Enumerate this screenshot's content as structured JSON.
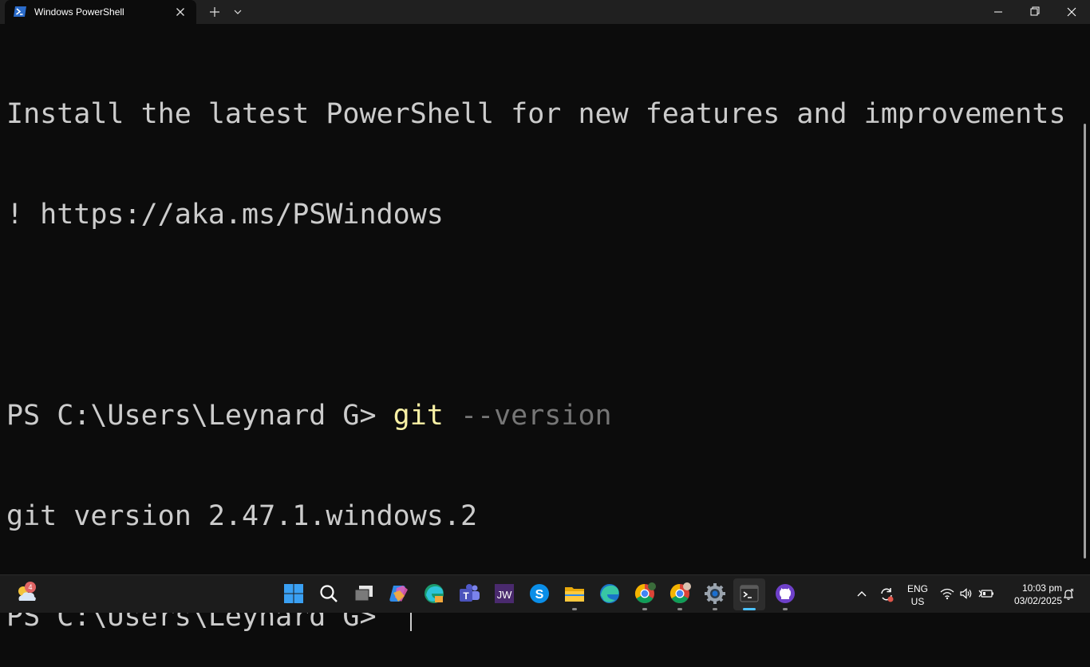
{
  "window": {
    "tab_title": "Windows PowerShell",
    "tab_icon": "powershell-icon"
  },
  "terminal": {
    "banner_line1": "Install the latest PowerShell for new features and improvements",
    "banner_line2": "! https://aka.ms/PSWindows",
    "prompt": "PS C:\\Users\\Leynard G> ",
    "command": "git",
    "command_args": " --version",
    "output": "git version 2.47.1.windows.2",
    "prompt2": "PS C:\\Users\\Leynard G> "
  },
  "taskbar": {
    "weather_badge": "4",
    "apps": [
      "start-icon",
      "search-icon",
      "task-view-icon",
      "copilot-icon",
      "edge-dev-icon",
      "teams-icon",
      "jw-library-icon",
      "skype-icon",
      "file-explorer-icon",
      "edge-icon",
      "chrome-profile1-icon",
      "chrome-profile2-icon",
      "settings-icon",
      "terminal-icon",
      "github-desktop-icon"
    ],
    "language": "ENG",
    "region": "US",
    "time": "10:03 pm",
    "date": "03/02/2025"
  },
  "colors": {
    "terminal_bg": "#0c0c0c",
    "text": "#cccccc",
    "command": "#f9f1a5",
    "args": "#767676",
    "accent": "#4cc2ff"
  }
}
